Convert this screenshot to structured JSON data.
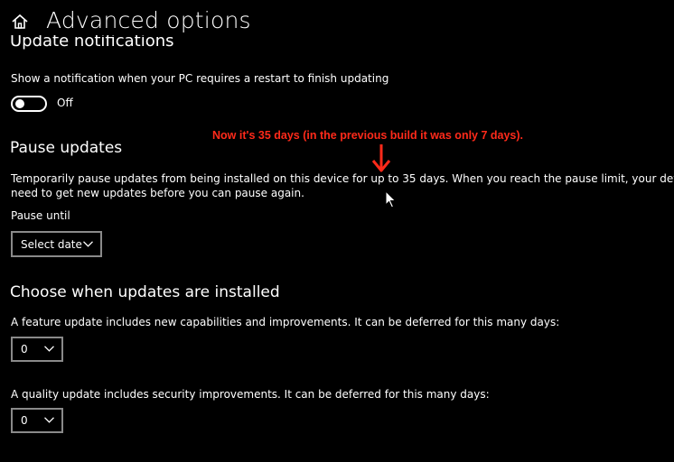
{
  "header": {
    "title": "Advanced options",
    "home_icon": "home-icon"
  },
  "notifications": {
    "heading": "Update notifications",
    "description": "Show a notification when your PC requires a restart to finish updating",
    "toggle_state": "Off"
  },
  "pause": {
    "heading": "Pause updates",
    "description_line1": "Temporarily pause updates from being installed on this device for up to 35 days. When you reach the pause limit, your device will",
    "description_line2": "need to get new updates before you can pause again.",
    "pause_until_label": "Pause until",
    "select_date": "Select date"
  },
  "annotation": {
    "text": "Now it's 35 days (in the previous build it was only 7 days).",
    "color": "#ff2a1a"
  },
  "choose": {
    "heading": "Choose when updates are installed",
    "feature_text": "A feature update includes new capabilities and improvements. It can be deferred for this many days:",
    "feature_value": "0",
    "quality_text": "A quality update includes security improvements. It can be deferred for this many days:",
    "quality_value": "0"
  }
}
